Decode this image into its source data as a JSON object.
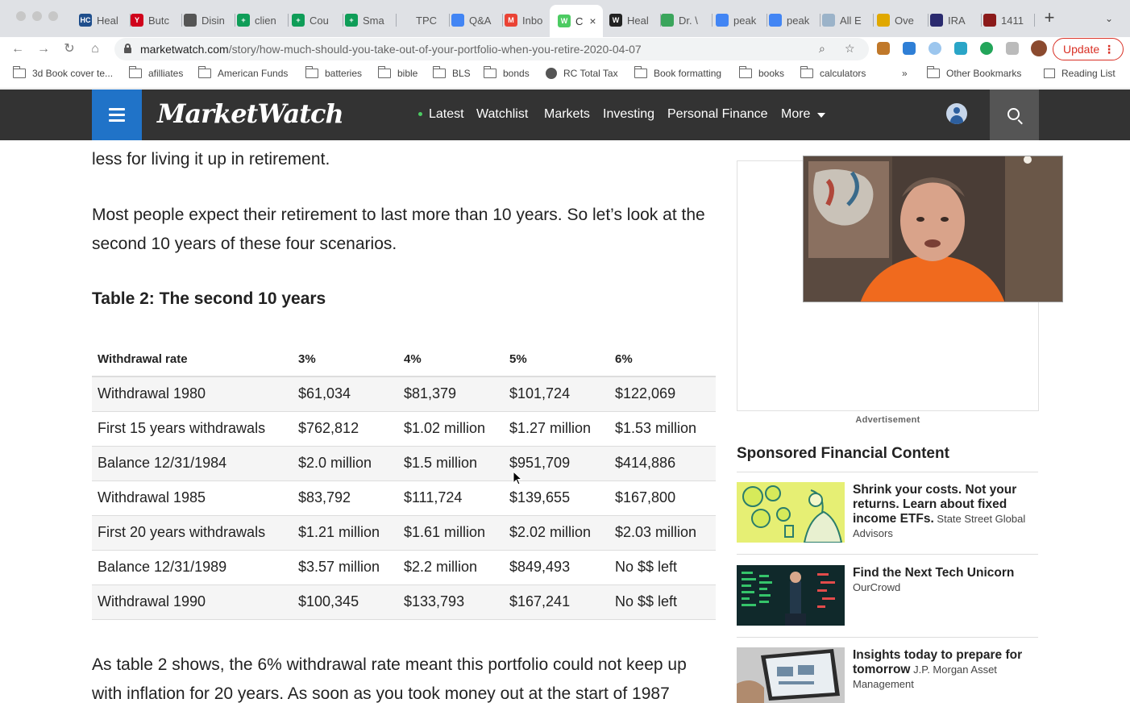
{
  "browser": {
    "tabs": [
      {
        "label": "Heal",
        "fav": "HC",
        "color": "#1f4e8c"
      },
      {
        "label": "Butc",
        "fav": "Y",
        "color": "#d0021b"
      },
      {
        "label": "Disin",
        "fav": "",
        "color": "#555555"
      },
      {
        "label": "clien",
        "fav": "+",
        "color": "#0f9d58"
      },
      {
        "label": "Cou",
        "fav": "+",
        "color": "#0f9d58"
      },
      {
        "label": "Sma",
        "fav": "+",
        "color": "#0f9d58"
      },
      {
        "label": "TPC",
        "fav": "",
        "color": "#dfe1e5"
      },
      {
        "label": "Q&A",
        "fav": "",
        "color": "#4285f4"
      },
      {
        "label": "Inbo",
        "fav": "M",
        "color": "#ea4335"
      },
      {
        "label": "C",
        "fav": "W",
        "color": "#4ccb62"
      },
      {
        "label": "Heal",
        "fav": "W",
        "color": "#222222"
      },
      {
        "label": "Dr. \\",
        "fav": "",
        "color": "#3ba55c"
      },
      {
        "label": "peak",
        "fav": "",
        "color": "#4285f4"
      },
      {
        "label": "peak",
        "fav": "",
        "color": "#4285f4"
      },
      {
        "label": "All E",
        "fav": "",
        "color": "#9bb3c9"
      },
      {
        "label": "Ove",
        "fav": "",
        "color": "#e0a800"
      },
      {
        "label": "IRA",
        "fav": "",
        "color": "#2a2a6e"
      },
      {
        "label": "1411",
        "fav": "",
        "color": "#8b1a1a"
      }
    ],
    "new_tab_symbol": "+",
    "tab_menu_symbol": "⌄",
    "close_symbol": "×",
    "url_host": "marketwatch.com",
    "url_path": "/story/how-much-should-you-take-out-of-your-portfolio-when-you-retire-2020-04-07",
    "update_label": "Update",
    "update_dots": "⋮",
    "bookmarks": [
      {
        "label": "3d Book cover te...",
        "icon": "folder-icon"
      },
      {
        "label": "afilliates",
        "icon": "folder-icon"
      },
      {
        "label": "American Funds",
        "icon": "folder-icon"
      },
      {
        "label": "batteries",
        "icon": "folder-icon"
      },
      {
        "label": "bible",
        "icon": "folder-icon"
      },
      {
        "label": "BLS",
        "icon": "folder-icon"
      },
      {
        "label": "bonds",
        "icon": "folder-icon"
      },
      {
        "label": "RC Total Tax",
        "icon": "globe-icon"
      },
      {
        "label": "Book formatting",
        "icon": "folder-icon"
      },
      {
        "label": "books",
        "icon": "folder-icon"
      },
      {
        "label": "calculators",
        "icon": "folder-icon"
      }
    ],
    "bookmarks_overflow": "»",
    "other_bookmarks": "Other Bookmarks",
    "reading_list": "Reading List"
  },
  "site": {
    "logo": "MarketWatch",
    "nav": [
      "Latest",
      "Watchlist",
      "Markets",
      "Investing",
      "Personal Finance",
      "More"
    ]
  },
  "article": {
    "p_top": "less for living it up in retirement.",
    "p1": "Most people expect their retirement to last more than 10 years. So let’s look at the second 10 years of these four scenarios.",
    "table_title": "Table 2: The second 10 years",
    "table": {
      "headers": [
        "Withdrawal rate",
        "3%",
        "4%",
        "5%",
        "6%"
      ],
      "rows": [
        [
          "Withdrawal 1980",
          "$61,034",
          "$81,379",
          "$101,724",
          "$122,069"
        ],
        [
          "First 15 years withdrawals",
          "$762,812",
          "$1.02 million",
          "$1.27 million",
          "$1.53 million"
        ],
        [
          "Balance 12/31/1984",
          "$2.0 million",
          "$1.5 million",
          "$951,709",
          "$414,886"
        ],
        [
          "Withdrawal 1985",
          "$83,792",
          "$111,724",
          "$139,655",
          "$167,800"
        ],
        [
          "First 20 years withdrawals",
          "$1.21 million",
          "$1.61 million",
          "$2.02 million",
          "$2.03 million"
        ],
        [
          "Balance 12/31/1989",
          "$3.57 million",
          "$2.2 million",
          "$849,493",
          "No $$ left"
        ],
        [
          "Withdrawal 1990",
          "$100,345",
          "$133,793",
          "$167,241",
          "No $$ left"
        ]
      ]
    },
    "p2_line1": "As table 2 shows, the 6% withdrawal rate meant this portfolio could not keep up",
    "p2_line2": "with inflation for 20 years. As soon as you took money out at the start of 1987"
  },
  "sidebar": {
    "ad_label": "Advertisement",
    "sponsored_title": "Sponsored Financial Content",
    "items": [
      {
        "headline": "Shrink your costs. Not your returns. Learn about fixed income ETFs.",
        "source": "State Street Global Advisors"
      },
      {
        "headline": "Find the Next Tech Unicorn",
        "source": "OurCrowd"
      },
      {
        "headline": "Insights today to prepare for tomorrow",
        "source": "J.P. Morgan Asset Management"
      }
    ]
  }
}
